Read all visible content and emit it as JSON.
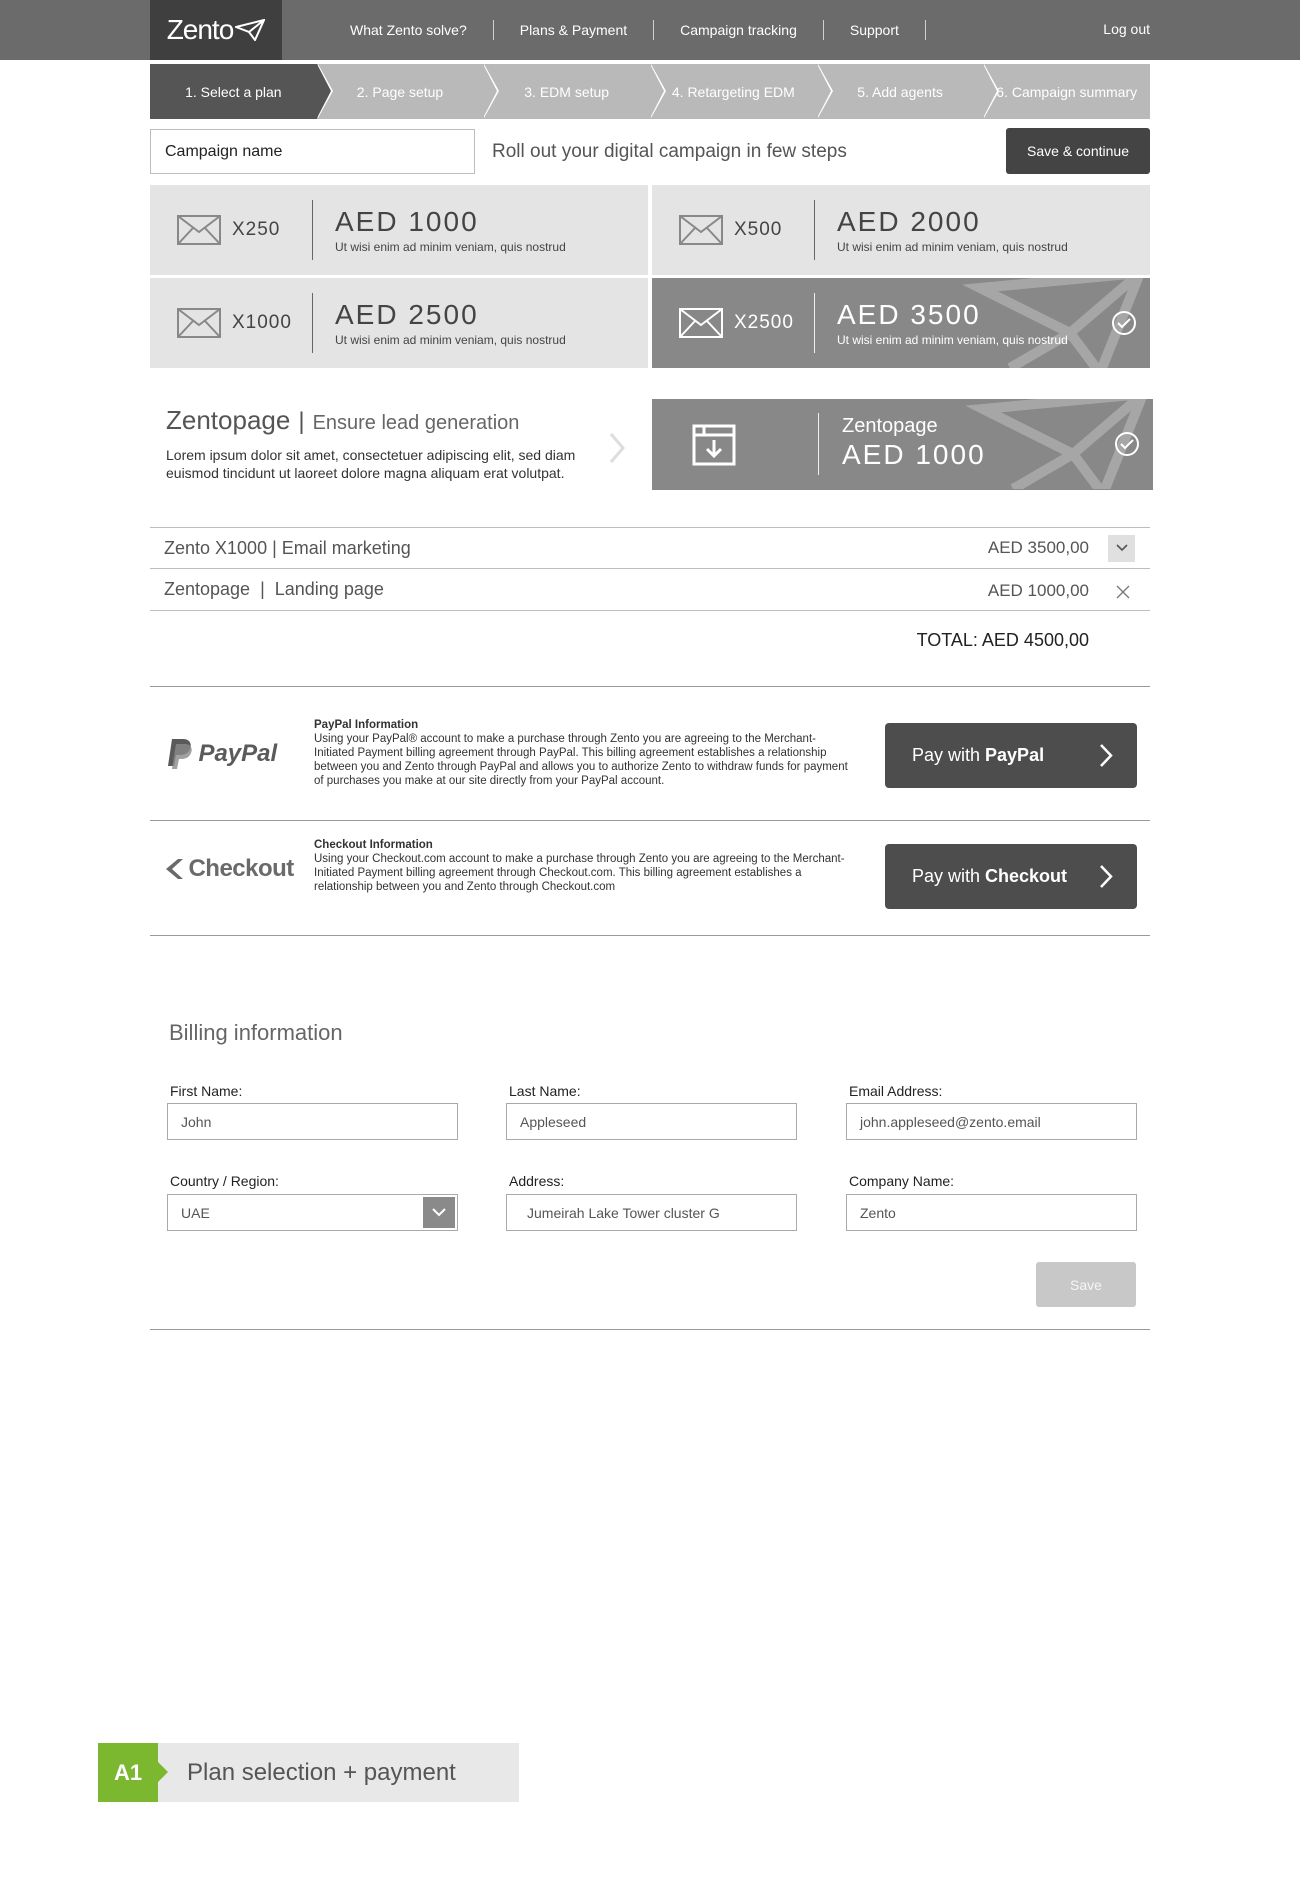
{
  "header": {
    "logo_text": "Zento",
    "nav": [
      "What Zento solve?",
      "Plans & Payment",
      "Campaign tracking",
      "Support"
    ],
    "logout": "Log out"
  },
  "steps": [
    "1. Select a plan",
    "2. Page setup",
    "3. EDM setup",
    "4. Retargeting EDM",
    "5. Add agents",
    "6. Campaign summary"
  ],
  "campaign": {
    "name_value": "Campaign name",
    "tagline": "Roll out your digital campaign in few steps",
    "save_continue": "Save & continue"
  },
  "plans": [
    {
      "qty": "X250",
      "price": "AED 1000",
      "desc": "Ut wisi enim ad minim veniam, quis nostrud",
      "selected": false
    },
    {
      "qty": "X500",
      "price": "AED 2000",
      "desc": "Ut wisi enim ad minim veniam, quis nostrud",
      "selected": false
    },
    {
      "qty": "X1000",
      "price": "AED 2500",
      "desc": "Ut wisi enim ad minim veniam, quis nostrud",
      "selected": false
    },
    {
      "qty": "X2500",
      "price": "AED 3500",
      "desc": "Ut wisi enim ad minim veniam, quis nostrud",
      "selected": true
    }
  ],
  "zentopage": {
    "title": "Zentopage",
    "separator": "|",
    "subtitle": "Ensure lead generation",
    "desc": "Lorem ipsum dolor sit amet, consectetuer adipiscing elit, sed diam euismod tincidunt ut laoreet dolore magna aliquam erat volutpat.",
    "card_name": "Zentopage",
    "card_price": "AED 1000"
  },
  "cart": {
    "items": [
      {
        "name": "Zento X1000 | Email marketing",
        "price": "AED 3500,00"
      },
      {
        "name": "Zentopage  |  Landing page",
        "price": "AED 1000,00"
      }
    ],
    "total": "TOTAL: AED 4500,00"
  },
  "payment": {
    "paypal": {
      "logo": "PayPal",
      "title": "PayPal Information",
      "text": "Using your PayPal® account to make a purchase through Zento you are agreeing to the Merchant-Initiated Payment billing agreement through PayPal. This billing agreement establishes a relationship between you and Zento through PayPal and allows you to authorize Zento to withdraw funds for payment of purchases you make at our site directly from your PayPal account.",
      "btn_prefix": "Pay with",
      "btn_brand": "PayPal"
    },
    "checkout": {
      "logo": "Checkout",
      "title": "Checkout Information",
      "text": "Using your Checkout.com account to make a purchase through Zento you are agreeing to the Merchant-Initiated Payment billing agreement through Checkout.com. This billing agreement establishes a relationship between you and Zento through Checkout.com",
      "btn_prefix": "Pay with",
      "btn_brand": "Checkout"
    }
  },
  "billing": {
    "title": "Billing information",
    "first_name_label": "First Name:",
    "first_name": "John",
    "last_name_label": "Last Name:",
    "last_name": "Appleseed",
    "email_label": "Email Address:",
    "email": "john.appleseed@zento.email",
    "country_label": "Country / Region:",
    "country": "UAE",
    "address_label": "Address:",
    "address": "Jumeirah Lake Tower cluster G",
    "company_label": "Company Name:",
    "company": "Zento",
    "save": "Save"
  },
  "page_label": {
    "code": "A1",
    "title": "Plan selection + payment"
  },
  "colors": {
    "accent_green": "#7cb82f",
    "dark": "#444444",
    "selected_card": "#888888"
  }
}
